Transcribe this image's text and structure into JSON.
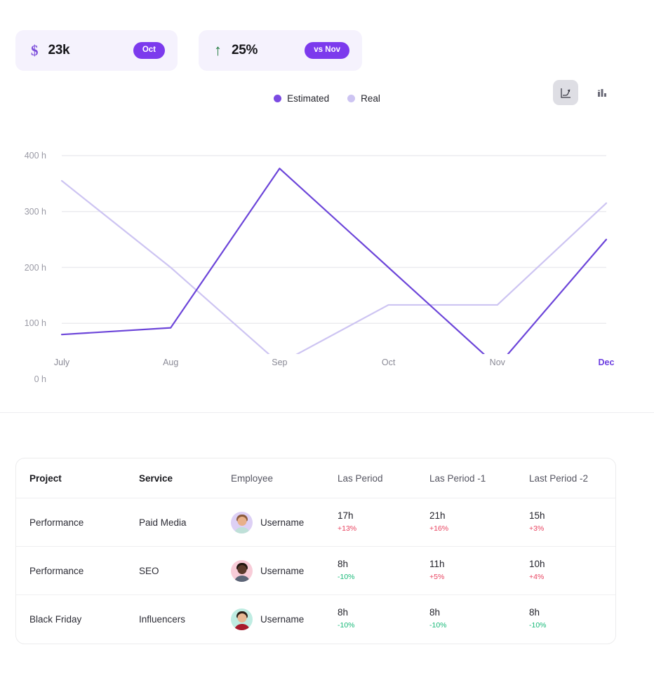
{
  "kpis": [
    {
      "icon": "dollar-icon",
      "icon_glyph": "$",
      "value": "23k",
      "badge": "Oct"
    },
    {
      "icon": "arrow-up-icon",
      "icon_glyph": "↑",
      "value": "25%",
      "badge": "vs Nov"
    }
  ],
  "chart_toolbar": {
    "line_view": "line-chart-icon",
    "bar_view": "bar-chart-icon",
    "active": "line"
  },
  "legend": [
    {
      "label": "Estimated",
      "color": "#7b4ae2"
    },
    {
      "label": "Real",
      "color": "#cdc4f2"
    }
  ],
  "chart_data": {
    "type": "line",
    "title": "",
    "xlabel": "",
    "ylabel": "",
    "categories": [
      "July",
      "Aug",
      "Sep",
      "Oct",
      "Nov",
      "Dec"
    ],
    "active_category": "Dec",
    "ylim": [
      0,
      400
    ],
    "yticks": [
      0,
      100,
      200,
      300,
      400
    ],
    "ytick_labels": [
      "0 h",
      "100 h",
      "200 h",
      "300 h",
      "400 h"
    ],
    "grid": true,
    "legend_position": "top-center",
    "series": [
      {
        "name": "Estimated",
        "color": "#6c45d9",
        "values": [
          80,
          92,
          377,
          200,
          23,
          250
        ]
      },
      {
        "name": "Real",
        "color": "#cdc4f2",
        "values": [
          355,
          200,
          28,
          133,
          133,
          315
        ]
      }
    ]
  },
  "table": {
    "columns": [
      "Project",
      "Service",
      "Employee",
      "Las Period",
      "Las Period -1",
      "Last Period -2"
    ],
    "rows": [
      {
        "project": "Performance",
        "service": "Paid Media",
        "employee": "Username",
        "avatar": {
          "bg": "#ddd0f5",
          "skin": "#e8b08a",
          "hair": "#8b5a3c",
          "body": "#bfe0d8"
        },
        "p0": {
          "value": "17h",
          "delta": "+13%",
          "dir": "up"
        },
        "p1": {
          "value": "21h",
          "delta": "+16%",
          "dir": "up"
        },
        "p2": {
          "value": "15h",
          "delta": "+3%",
          "dir": "up"
        }
      },
      {
        "project": "Performance",
        "service": "SEO",
        "employee": "Username",
        "avatar": {
          "bg": "#f8ccd8",
          "skin": "#5b3a2c",
          "hair": "#21160f",
          "body": "#5c6577"
        },
        "p0": {
          "value": "8h",
          "delta": "-10%",
          "dir": "down"
        },
        "p1": {
          "value": "11h",
          "delta": "+5%",
          "dir": "up"
        },
        "p2": {
          "value": "10h",
          "delta": "+4%",
          "dir": "up"
        }
      },
      {
        "project": "Black Friday",
        "service": "Influencers",
        "employee": "Username",
        "avatar": {
          "bg": "#bfece2",
          "skin": "#e8b894",
          "hair": "#2b1f18",
          "body": "#a81a2c"
        },
        "p0": {
          "value": "8h",
          "delta": "-10%",
          "dir": "down"
        },
        "p1": {
          "value": "8h",
          "delta": "-10%",
          "dir": "down"
        },
        "p2": {
          "value": "8h",
          "delta": "-10%",
          "dir": "down"
        }
      }
    ]
  }
}
